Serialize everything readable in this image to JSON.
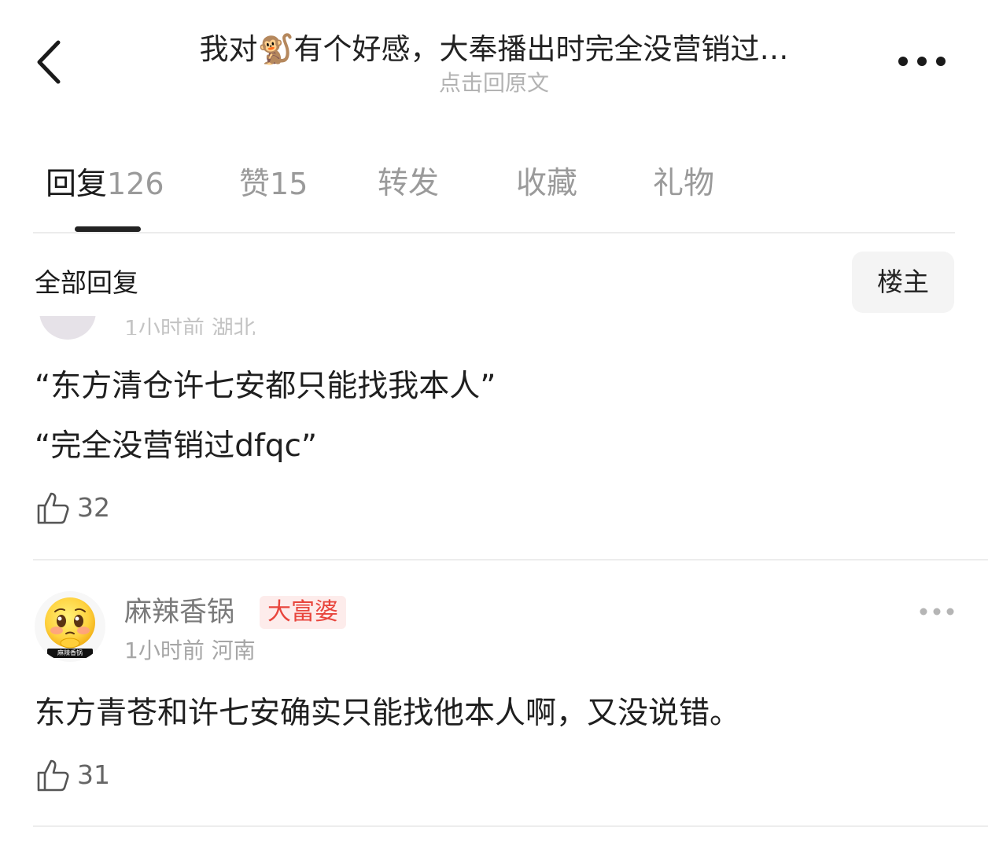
{
  "header": {
    "title": "我对🐒有个好感，大奉播出时完全没营销过…",
    "subtitle": "点击回原文"
  },
  "tabs": [
    {
      "label": "回复",
      "count": "126",
      "active": true
    },
    {
      "label": "赞",
      "count": "15",
      "active": false
    },
    {
      "label": "转发",
      "count": "",
      "active": false
    },
    {
      "label": "收藏",
      "count": "",
      "active": false
    },
    {
      "label": "礼物",
      "count": "",
      "active": false
    }
  ],
  "section": {
    "title": "全部回复",
    "op_filter": "楼主"
  },
  "comments": [
    {
      "meta_partial": "1小时前 湖北",
      "lines": [
        "“东方清仓许七安都只能找我本人”",
        "“完全没营销过dfqc”"
      ],
      "likes": "32"
    },
    {
      "username": "麻辣香锅",
      "badge": "大富婆",
      "time": "1小时前",
      "location": "河南",
      "avatar_caption": "麻辣香锅",
      "lines": [
        "东方青苍和许七安确实只能找他本人啊，又没说错。"
      ],
      "likes": "31"
    }
  ],
  "colors": {
    "badge_bg": "#fdeceb",
    "badge_text": "#e8453c",
    "tab_indicator": "#222222"
  }
}
